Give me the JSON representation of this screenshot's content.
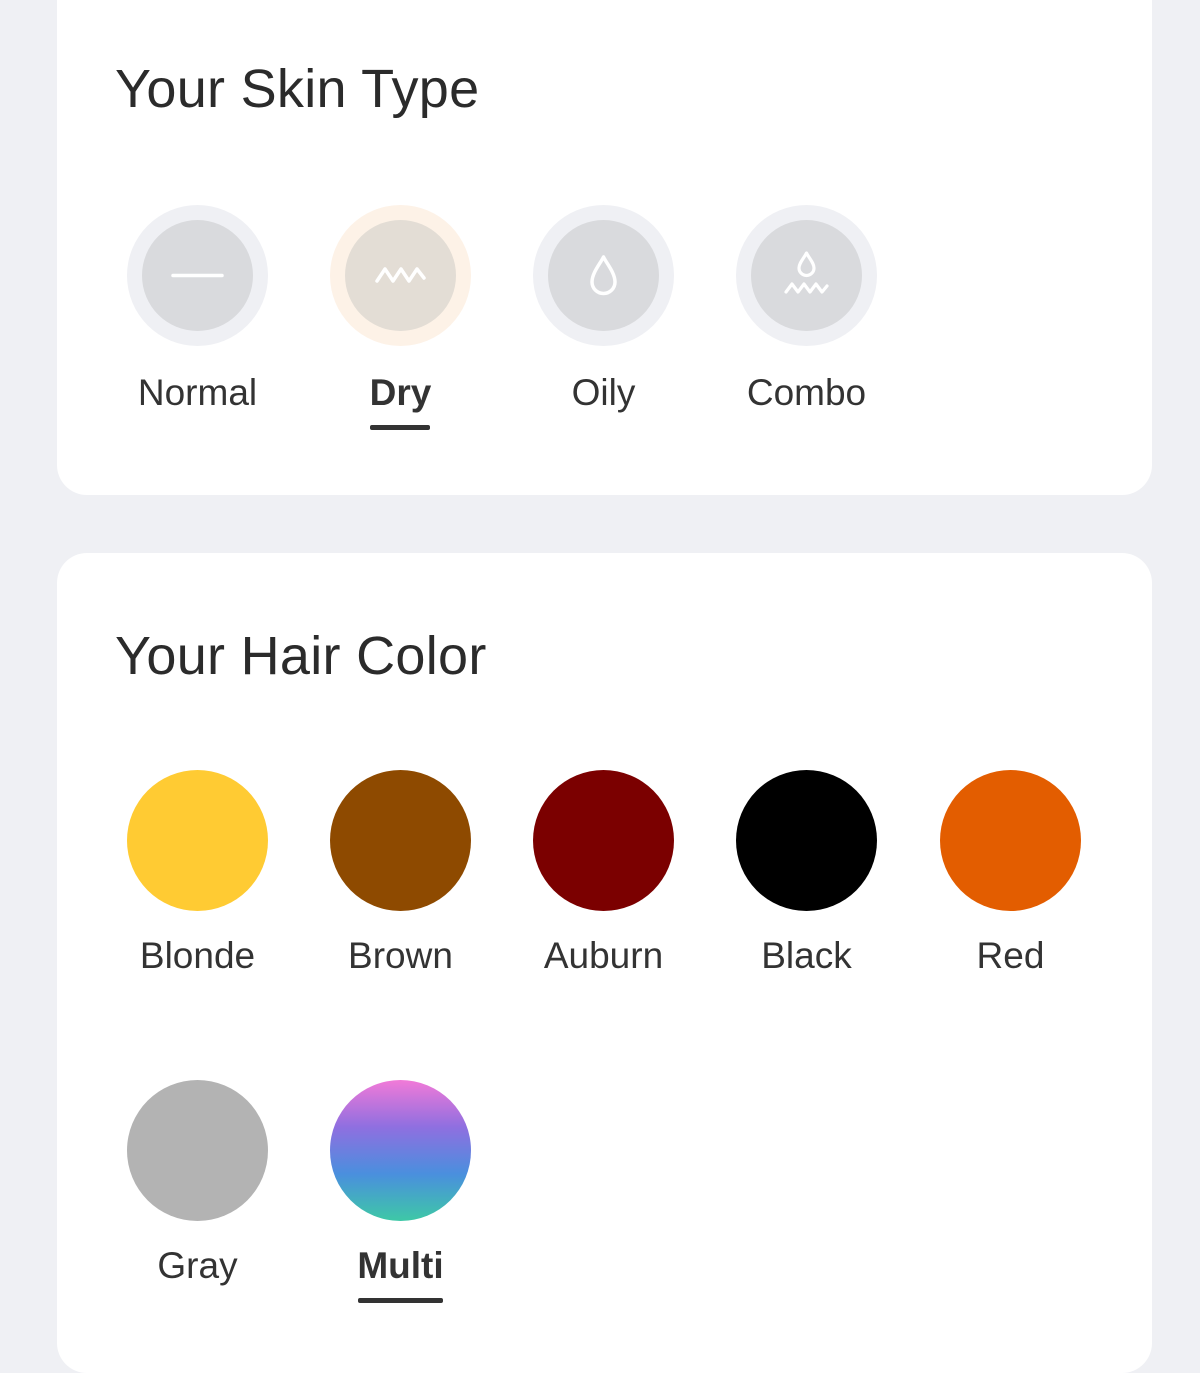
{
  "skin_type": {
    "title": "Your Skin Type",
    "selected": "Dry",
    "options": [
      {
        "label": "Normal",
        "icon": "flat-line-icon"
      },
      {
        "label": "Dry",
        "icon": "zigzag-icon"
      },
      {
        "label": "Oily",
        "icon": "drop-icon"
      },
      {
        "label": "Combo",
        "icon": "drop-wave-icon"
      }
    ]
  },
  "hair_color": {
    "title": "Your Hair Color",
    "selected": "Multi",
    "options": [
      {
        "label": "Blonde",
        "color": "#ffcb33"
      },
      {
        "label": "Brown",
        "color": "#8e4a00"
      },
      {
        "label": "Auburn",
        "color": "#7b0000"
      },
      {
        "label": "Black",
        "color": "#000000"
      },
      {
        "label": "Red",
        "color": "#e35d00"
      },
      {
        "label": "Gray",
        "color": "#b3b3b3"
      },
      {
        "label": "Multi",
        "gradient": [
          "#f17ad8",
          "#8f6fe0",
          "#4a8fde",
          "#3ec8a6"
        ]
      }
    ]
  },
  "colors": {
    "background": "#eff0f4",
    "card": "#ffffff",
    "text": "#2b2b2b",
    "icon_stroke": "#ffffff",
    "skin_circle": "#d9dadd",
    "selected_skin_circle": "#e3ddd5",
    "selected_skin_ring": "#fdf2e7"
  }
}
